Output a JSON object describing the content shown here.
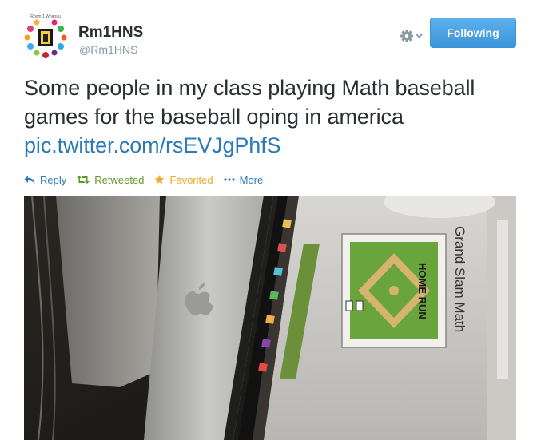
{
  "user": {
    "avatar_caption": "Room 1 Whanau",
    "name": "Rm1HNS",
    "handle": "@Rm1HNS"
  },
  "follow_button": {
    "label": "Following",
    "color": "#3b94d9"
  },
  "tweet": {
    "text": "Some people in my class playing Math baseball games for the baseball oping in america ",
    "link": "pic.twitter.com/rsEVJgPhfS"
  },
  "actions": {
    "reply": "Reply",
    "retweet": "Retweeted",
    "favorite": "Favorited",
    "more": "More"
  },
  "colors": {
    "link": "#2b7bb9",
    "retweeted": "#609928",
    "favorited": "#f5a623",
    "muted": "#8899a6"
  },
  "photo": {
    "screen_title": "Grand Slam Math",
    "screen_label": "HOME RUN",
    "sidebar_text": "Grand Slam Math"
  }
}
